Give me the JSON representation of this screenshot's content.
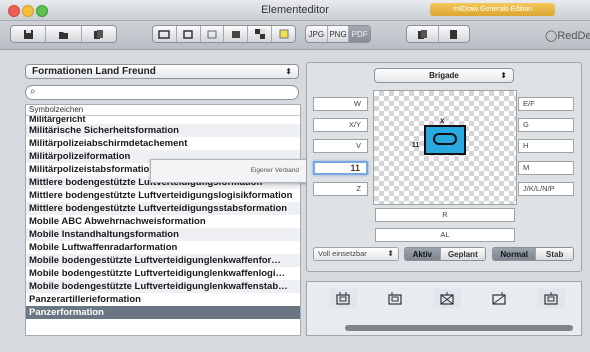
{
  "window": {
    "title": "Elementeditor",
    "edition_badge": "milDraw Generals-Edition"
  },
  "toolbar": {
    "format_buttons": [
      "JPG",
      "PNG",
      "PDF"
    ],
    "logo": "RedDev"
  },
  "left": {
    "category_select": "Formationen Land Freund",
    "search_placeholder": "",
    "list_header": "Symbolzeichen",
    "items": [
      "Militärgericht",
      "Militärische Sicherheitsformation",
      "Militärpolizeiabschirmdetachement",
      "Militärpolizeiformation",
      "Militärpolizeistabsformation",
      "Mittlere bodengestützte Luftverteidigungsformation",
      "Mittlere bodengestützte Luftverteidigungslogisikformation",
      "Mittlere bodengestützte Luftverteidigungsstabsformation",
      "Mobile ABC Abwehrnachweisformation",
      "Mobile Instandhaltungsformation",
      "Mobile Luftwaffenradarformation",
      "Mobile bodengestützte Luftverteidigunglenkwaffenfor…",
      "Mobile bodengestützte Luftverteidigunglenkwaffenlogi…",
      "Mobile bodengestützte Luftverteidigunglenkwaffenstab…",
      "Panzerartillerieformation",
      "Panzerformation"
    ],
    "tooltip": "Eigener Verband"
  },
  "right": {
    "size_select": "Brigade",
    "left_fields": [
      "W",
      "X/Y",
      "V",
      "11",
      "Z"
    ],
    "right_fields": [
      "E/F",
      "G",
      "H",
      "M",
      "J/K/L/N/P"
    ],
    "bottom_fields": [
      "R",
      "AL"
    ],
    "symbol_top_label": "x",
    "symbol_side_label": "11",
    "strength_select": "Voll einsetzbar",
    "status_segments": [
      "Aktiv",
      "Geplant"
    ],
    "type_segments": [
      "Normal",
      "Stab"
    ]
  },
  "colors": {
    "symbol_fill": "#2aa9e0",
    "selection": "#6a7683",
    "focus": "#7aa7e0"
  }
}
